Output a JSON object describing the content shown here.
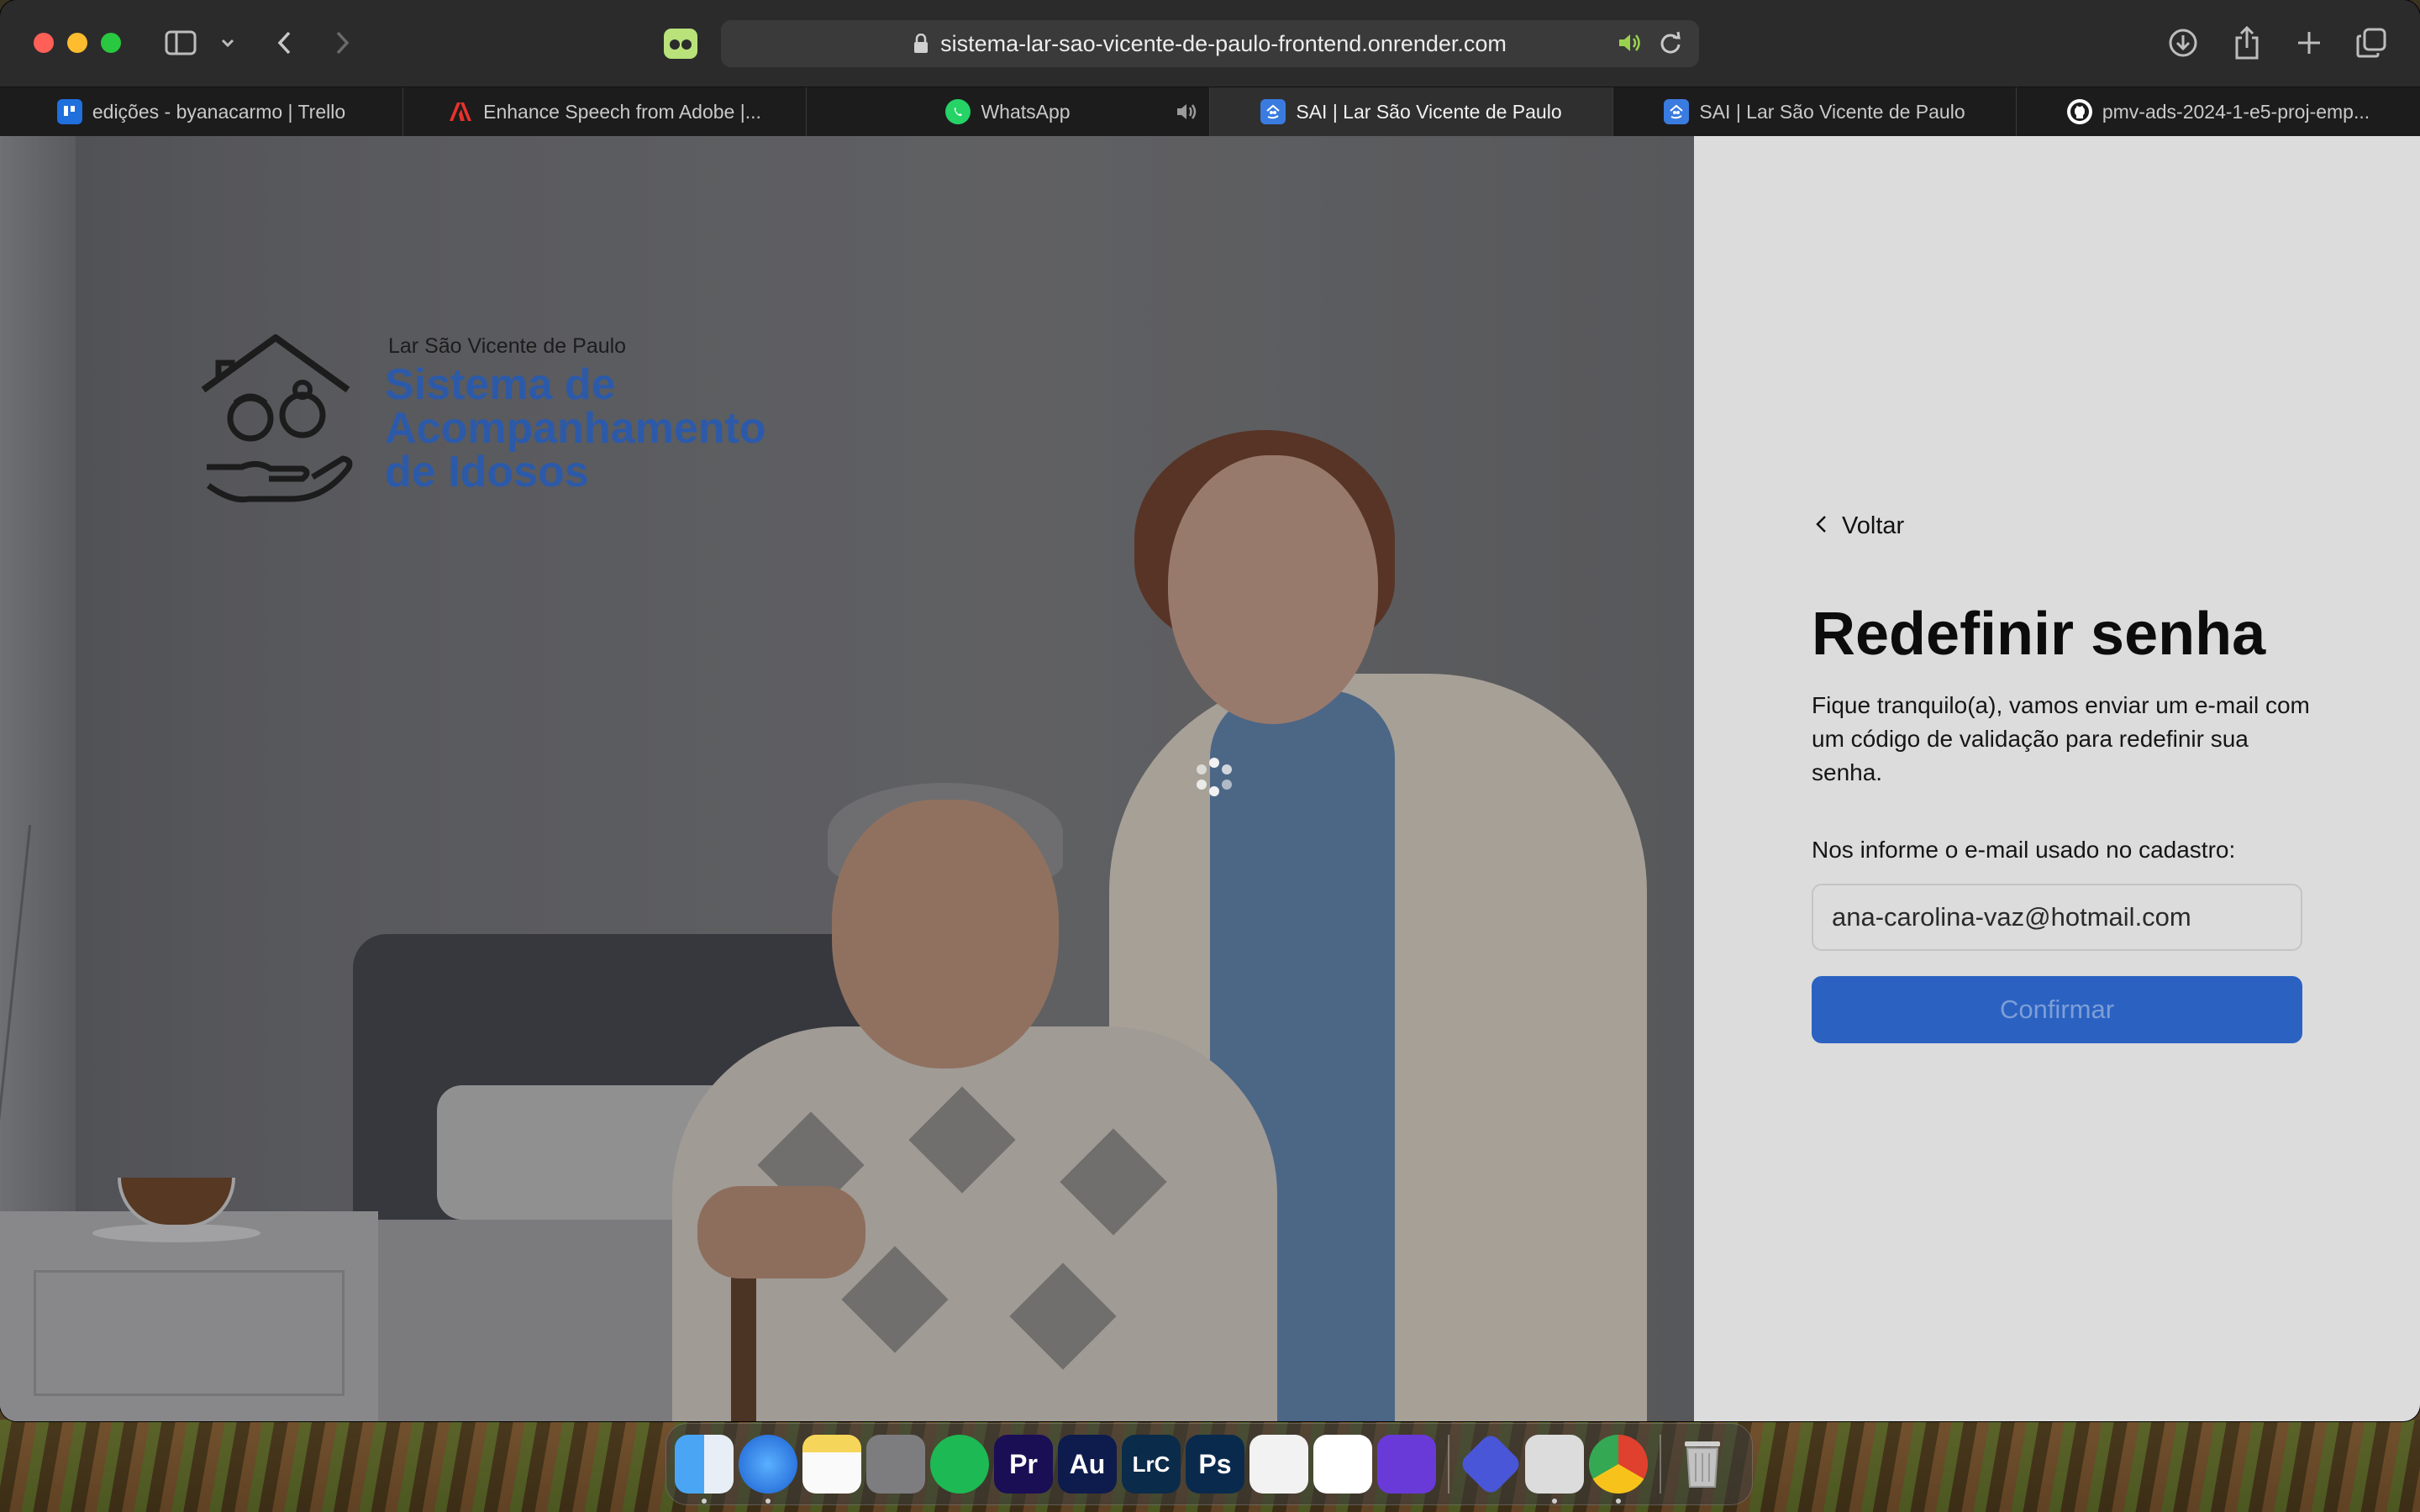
{
  "browser": {
    "url": "sistema-lar-sao-vicente-de-paulo-frontend.onrender.com",
    "tabs": [
      {
        "label": "edições - byanacarmo | Trello",
        "icon": "trello-icon",
        "color": "#1f6fdd"
      },
      {
        "label": "Enhance Speech from Adobe |...",
        "icon": "adobe-icon",
        "color": "#e8322b"
      },
      {
        "label": "WhatsApp",
        "icon": "whatsapp-icon",
        "color": "#25d366"
      },
      {
        "label": "SAI | Lar São Vicente de Paulo",
        "icon": "sai-icon",
        "color": "#3a7be0",
        "active": true
      },
      {
        "label": "SAI | Lar São Vicente de Paulo",
        "icon": "sai-icon",
        "color": "#3a7be0"
      },
      {
        "label": "pmv-ads-2024-1-e5-proj-emp...",
        "icon": "github-icon",
        "color": "#ffffff"
      }
    ]
  },
  "brand": {
    "small": "Lar São Vicente de Paulo",
    "line1": "Sistema de",
    "line2": "Acompanhamento",
    "line3": "de Idosos",
    "color": "#2c5aa9"
  },
  "form": {
    "back_label": "Voltar",
    "title": "Redefinir senha",
    "description": "Fique tranquilo(a), vamos enviar um e-mail com um código de validação para redefinir sua senha.",
    "email_label": "Nos informe o e-mail usado no cadastro:",
    "email_value": "ana-carolina-vaz@hotmail.com",
    "confirm_label": "Confirmar",
    "button_color": "#2b62c2"
  },
  "dock": {
    "apps": [
      {
        "name": "finder-icon",
        "text": "",
        "bg": "#3b8df0",
        "running": true
      },
      {
        "name": "safari-icon",
        "text": "",
        "bg": "#2a7ef0",
        "running": true
      },
      {
        "name": "notes-icon",
        "text": "",
        "bg": "#f6d65a",
        "running": false
      },
      {
        "name": "system-settings-icon",
        "text": "",
        "bg": "#7d7d80",
        "running": false
      },
      {
        "name": "spotify-icon",
        "text": "",
        "bg": "#1db954",
        "running": false
      },
      {
        "name": "premiere-icon",
        "text": "Pr",
        "bg": "#1a0e55",
        "running": false
      },
      {
        "name": "audition-icon",
        "text": "Au",
        "bg": "#0d1b4d",
        "running": false
      },
      {
        "name": "lightroom-classic-icon",
        "text": "LrC",
        "bg": "#0b2b4a",
        "running": false
      },
      {
        "name": "photoshop-icon",
        "text": "Ps",
        "bg": "#0a2a4d",
        "running": false
      },
      {
        "name": "davinci-icon",
        "text": "",
        "bg": "#f2f2f2",
        "running": false
      },
      {
        "name": "google-drive-icon",
        "text": "",
        "bg": "#ffffff",
        "running": false
      },
      {
        "name": "magnifier-app-icon",
        "text": "",
        "bg": "#6a3ad8",
        "running": false
      }
    ],
    "apps2": [
      {
        "name": "video-player-icon",
        "text": "",
        "bg": "#4a56d8",
        "running": false
      },
      {
        "name": "preview-icon",
        "text": "",
        "bg": "#dcdcdc",
        "running": true
      },
      {
        "name": "chrome-icon",
        "text": "",
        "bg": "#ffffff",
        "running": true
      }
    ]
  }
}
